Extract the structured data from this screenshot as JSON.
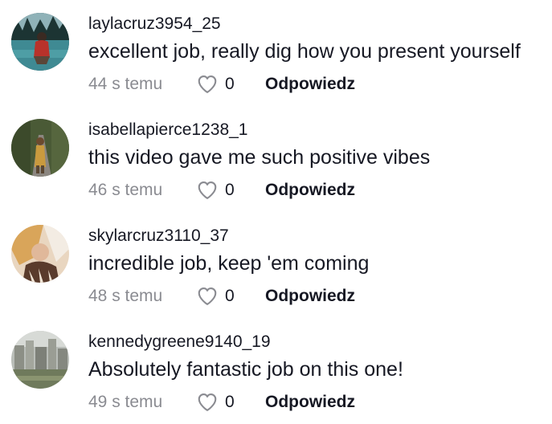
{
  "comments": [
    {
      "username": "laylacruz3954_25",
      "text": "excellent job, really dig how you present yourself",
      "time": "44 s temu",
      "likes": "0",
      "reply_label": "Odpowiedz"
    },
    {
      "username": "isabellapierce1238_1",
      "text": "this video gave me such positive vibes",
      "time": "46 s temu",
      "likes": "0",
      "reply_label": "Odpowiedz"
    },
    {
      "username": "skylarcruz3110_37",
      "text": "incredible job, keep 'em coming",
      "time": "48 s temu",
      "likes": "0",
      "reply_label": "Odpowiedz"
    },
    {
      "username": "kennedygreene9140_19",
      "text": "Absolutely fantastic job on this one!",
      "time": "49 s temu",
      "likes": "0",
      "reply_label": "Odpowiedz"
    }
  ],
  "icons": {
    "like": "heart-outline-icon"
  },
  "colors": {
    "primary_text": "#161823",
    "secondary_text": "#8a8b91"
  }
}
